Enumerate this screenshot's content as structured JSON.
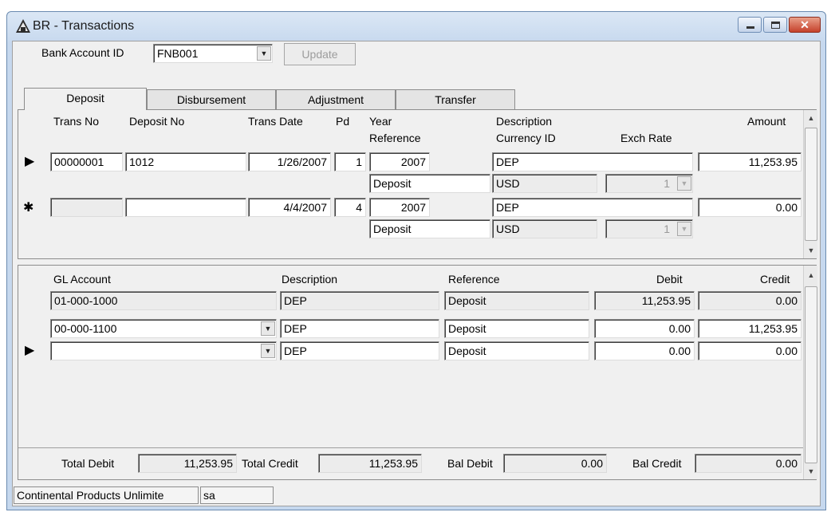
{
  "window": {
    "title": "BR - Transactions"
  },
  "header": {
    "bank_account_label": "Bank Account ID",
    "bank_account_value": "FNB001",
    "update_label": "Update"
  },
  "tabs": [
    {
      "label": "Deposit",
      "active": true
    },
    {
      "label": "Disbursement",
      "active": false
    },
    {
      "label": "Adjustment",
      "active": false
    },
    {
      "label": "Transfer",
      "active": false
    }
  ],
  "upper_grid": {
    "headers": {
      "trans_no": "Trans No",
      "deposit_no": "Deposit No",
      "trans_date": "Trans Date",
      "pd": "Pd",
      "year": "Year",
      "reference": "Reference",
      "description": "Description",
      "currency_id": "Currency ID",
      "exch_rate": "Exch Rate",
      "amount": "Amount"
    },
    "rows": [
      {
        "indicator": "▶",
        "trans_no": "00000001",
        "deposit_no": "1012",
        "trans_date": "1/26/2007",
        "pd": "1",
        "year": "2007",
        "description": "DEP",
        "amount": "11,253.95",
        "reference": "Deposit",
        "currency": "USD",
        "exch_rate": "1"
      },
      {
        "indicator": "✱",
        "trans_no": "",
        "deposit_no": "",
        "trans_date": "4/4/2007",
        "pd": "4",
        "year": "2007",
        "description": "DEP",
        "amount": "0.00",
        "reference": "Deposit",
        "currency": "USD",
        "exch_rate": "1"
      }
    ]
  },
  "lower_grid": {
    "headers": {
      "gl_account": "GL Account",
      "description": "Description",
      "reference": "Reference",
      "debit": "Debit",
      "credit": "Credit"
    },
    "rows": [
      {
        "indicator": "",
        "gl_account": "01-000-1000",
        "description": "DEP",
        "reference": "Deposit",
        "debit": "11,253.95",
        "credit": "0.00",
        "readonly": true
      },
      {
        "indicator": "",
        "gl_account": "00-000-1100",
        "description": "DEP",
        "reference": "Deposit",
        "debit": "0.00",
        "credit": "11,253.95",
        "readonly": false
      },
      {
        "indicator": "▶",
        "gl_account": "",
        "description": "DEP",
        "reference": "Deposit",
        "debit": "0.00",
        "credit": "0.00",
        "readonly": false
      }
    ]
  },
  "totals": {
    "total_debit_label": "Total Debit",
    "total_debit": "11,253.95",
    "total_credit_label": "Total Credit",
    "total_credit": "11,253.95",
    "bal_debit_label": "Bal Debit",
    "bal_debit": "0.00",
    "bal_credit_label": "Bal Credit",
    "bal_credit": "0.00"
  },
  "status": {
    "company": "Continental Products Unlimite",
    "user": "sa"
  }
}
